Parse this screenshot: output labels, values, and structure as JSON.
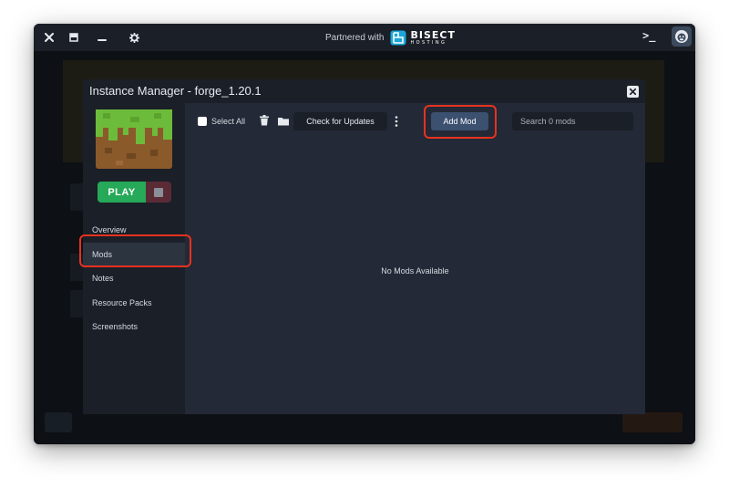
{
  "titlebar": {
    "partner_text": "Partnered with",
    "brand_name": "BISECT",
    "brand_sub": "HOSTING",
    "terminal_label": ">_"
  },
  "modal": {
    "title": "Instance Manager - forge_1.20.1"
  },
  "sidebar": {
    "play_label": "PLAY",
    "items": [
      {
        "label": "Overview"
      },
      {
        "label": "Mods"
      },
      {
        "label": "Notes"
      },
      {
        "label": "Resource Packs"
      },
      {
        "label": "Screenshots"
      }
    ],
    "active_index": 1
  },
  "toolbar": {
    "select_all_label": "Select All",
    "check_updates_label": "Check for Updates",
    "add_mod_label": "Add Mod",
    "search_placeholder": "Search 0 mods"
  },
  "content": {
    "empty_message": "No Mods Available"
  },
  "colors": {
    "accent_play": "#26a958",
    "highlight": "#e8321f",
    "add_mod_bg": "#3c5070"
  },
  "icons": {
    "close": "close-icon",
    "minimize_tray": "tray-icon",
    "minimize": "minimize-icon",
    "settings": "gear-icon",
    "terminal": "terminal-icon",
    "avatar": "gorilla-avatar-icon",
    "trash": "trash-icon",
    "folder": "folder-icon",
    "more": "more-vertical-icon",
    "stop": "stop-icon"
  }
}
